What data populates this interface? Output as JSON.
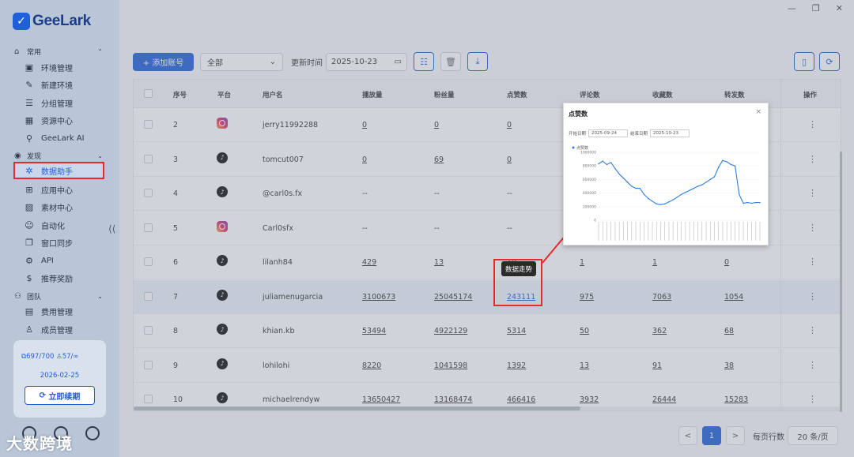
{
  "app": {
    "logo": "GeeLark"
  },
  "sidebar": {
    "sections": [
      {
        "label": "常用",
        "icon": "home-icon",
        "items": [
          {
            "label": "环境管理",
            "icon": "browser-icon"
          },
          {
            "label": "新建环境",
            "icon": "edit-icon"
          },
          {
            "label": "分组管理",
            "icon": "list-icon"
          },
          {
            "label": "资源中心",
            "icon": "resource-icon"
          },
          {
            "label": "GeeLark AI",
            "icon": "ai-icon"
          }
        ]
      },
      {
        "label": "发现",
        "icon": "eye-icon",
        "items": [
          {
            "label": "数据助手",
            "icon": "analytics-icon",
            "active": true
          },
          {
            "label": "应用中心",
            "icon": "apps-icon"
          },
          {
            "label": "素材中心",
            "icon": "image-icon"
          },
          {
            "label": "自动化",
            "icon": "robot-icon"
          },
          {
            "label": "窗口同步",
            "icon": "sync-icon"
          },
          {
            "label": "API",
            "icon": "api-icon"
          },
          {
            "label": "推荐奖励",
            "icon": "dollar-icon"
          }
        ]
      },
      {
        "label": "团队",
        "icon": "team-icon",
        "items": [
          {
            "label": "费用管理",
            "icon": "billing-icon"
          },
          {
            "label": "成员管理",
            "icon": "user-icon"
          }
        ]
      }
    ],
    "card": {
      "profiles": "697/700",
      "members": "57/∞",
      "date": "2026-02-25",
      "renew": "立即续期"
    }
  },
  "toolbar": {
    "add": "+ 添加账号",
    "filter": "全部",
    "time_label": "更新时间",
    "date": "2025-10-23"
  },
  "table": {
    "headers": [
      "序号",
      "平台",
      "用户名",
      "播放量",
      "粉丝量",
      "点赞数",
      "评论数",
      "收藏数",
      "转发数",
      "操作"
    ],
    "rows": [
      {
        "no": "2",
        "platform": "instagram",
        "user": "jerry11992288",
        "plays": "0",
        "fans": "0",
        "likes": "0",
        "comments": "",
        "favs": "",
        "shares": ""
      },
      {
        "no": "3",
        "platform": "tiktok",
        "user": "tomcut007",
        "plays": "0",
        "fans": "69",
        "likes": "0",
        "comments": "",
        "favs": "",
        "shares": ""
      },
      {
        "no": "4",
        "platform": "tiktok",
        "user": "@carl0s.fx",
        "plays": "--",
        "fans": "--",
        "likes": "--",
        "comments": "",
        "favs": "",
        "shares": ""
      },
      {
        "no": "5",
        "platform": "instagram",
        "user": "Carl0sfx",
        "plays": "--",
        "fans": "--",
        "likes": "--",
        "comments": "",
        "favs": "",
        "shares": ""
      },
      {
        "no": "6",
        "platform": "tiktok",
        "user": "lilanh84",
        "plays": "429",
        "fans": "13",
        "likes": "10",
        "comments": "1",
        "favs": "1",
        "shares": "0"
      },
      {
        "no": "7",
        "platform": "tiktok",
        "user": "juliamenugarcia",
        "plays": "3100673",
        "fans": "25045174",
        "likes": "243111",
        "comments": "975",
        "favs": "7063",
        "shares": "1054"
      },
      {
        "no": "8",
        "platform": "tiktok",
        "user": "khian.kb",
        "plays": "53494",
        "fans": "4922129",
        "likes": "5314",
        "comments": "50",
        "favs": "362",
        "shares": "68"
      },
      {
        "no": "9",
        "platform": "tiktok",
        "user": "lohilohi",
        "plays": "8220",
        "fans": "1041598",
        "likes": "1392",
        "comments": "13",
        "favs": "91",
        "shares": "38"
      },
      {
        "no": "10",
        "platform": "tiktok",
        "user": "michaelrendyw",
        "plays": "13650427",
        "fans": "13168474",
        "likes": "466416",
        "comments": "3932",
        "favs": "26444",
        "shares": "15283"
      }
    ]
  },
  "tooltip": "数据走势",
  "popup": {
    "title": "点赞数",
    "close": "×",
    "start_label": "开始日期",
    "start": "2025-09-24",
    "end_label": "结束日期",
    "end": "2025-10-23",
    "legend": "点赞数"
  },
  "pager": {
    "prev": "<",
    "page": "1",
    "next": ">",
    "rows_label": "每页行数",
    "rows_value": "20 条/页"
  },
  "watermark": "大数跨境",
  "chart_data": {
    "type": "line",
    "title": "点赞数",
    "series": [
      {
        "name": "点赞数",
        "values": [
          830000,
          870000,
          820000,
          850000,
          760000,
          680000,
          620000,
          560000,
          500000,
          470000,
          470000,
          380000,
          320000,
          280000,
          240000,
          230000,
          240000,
          270000,
          300000,
          340000,
          380000,
          410000,
          440000,
          470000,
          500000,
          520000,
          560000,
          600000,
          640000,
          780000,
          880000,
          860000,
          820000,
          800000,
          380000,
          250000,
          260000,
          250000,
          260000,
          260000
        ]
      }
    ],
    "ylim": [
      0,
      1000000
    ],
    "yticks": [
      "0",
      "200000",
      "400000",
      "600000",
      "800000",
      "1000000"
    ],
    "grid": true
  }
}
